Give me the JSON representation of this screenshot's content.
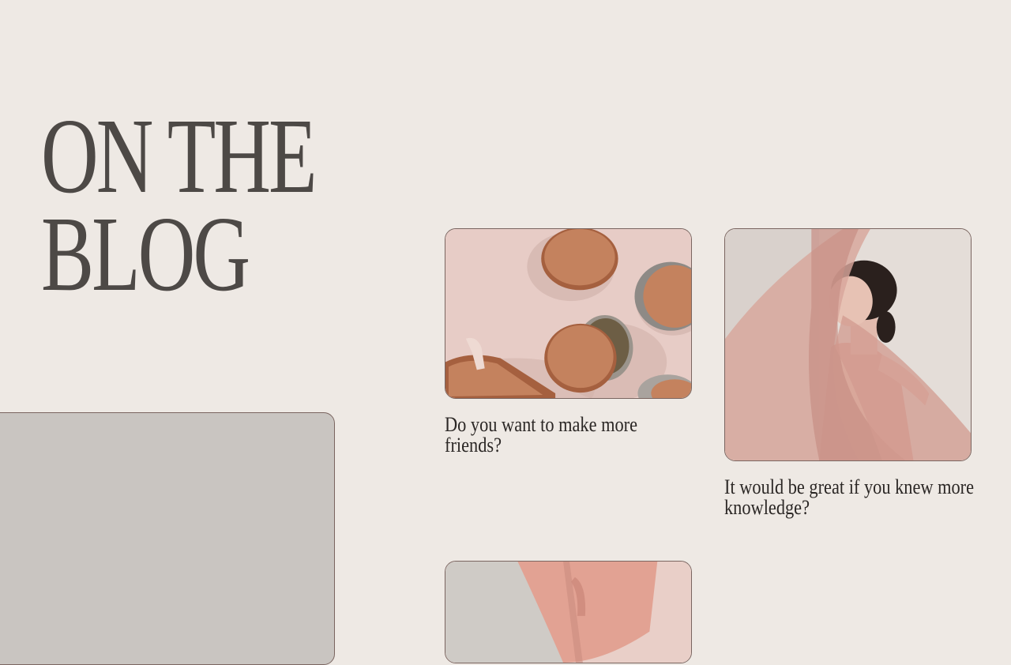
{
  "hero": {
    "title_line1": "ON THE",
    "title_line2": "BLOG"
  },
  "posts": [
    {
      "caption": "Do you want to make more friends?",
      "image_icon": "cork-coasters-photo"
    },
    {
      "caption": "It would be great if you knew more knowledge?",
      "image_icon": "woman-pink-veil-photo"
    },
    {
      "caption": "",
      "image_icon": "pink-fabric-photo"
    }
  ],
  "colors": {
    "background": "#EEE9E4",
    "heading": "#4D4946",
    "text": "#2B2725",
    "panel": "#C9C5C1",
    "border": "#7A6560",
    "blush": "#E2C9C4"
  }
}
